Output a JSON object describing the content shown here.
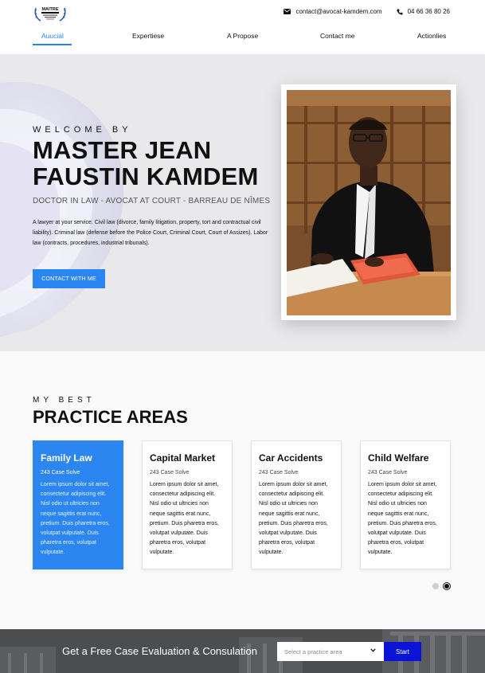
{
  "header": {
    "logo_text": "MAITRE KAMDEM",
    "email": "contact@avocat-kamdem.com",
    "phone": "04 66 36 80 26",
    "nav": [
      {
        "label": "Auucial"
      },
      {
        "label": "Expertiese"
      },
      {
        "label": "A Propose"
      },
      {
        "label": "Contact me"
      },
      {
        "label": "Actionlies"
      }
    ]
  },
  "hero": {
    "welcome": "WELCOME BY",
    "title_line1": "MASTER JEAN",
    "title_line2": "FAUSTIN KAMDEM",
    "subtitle": "DOCTOR IN LAW - AVOCAT AT COURT - BARREAU DE NÎMES",
    "description": "A lawyer at your service. Civil law (divorce, family litigation, property, tort and contractual civil liability). Criminal law (defense before the Police Court, Criminal Court, Court of Assizes). Labor law (contracts, procedures, industrial tribunals).",
    "cta_label": "CONTACT WITH ME"
  },
  "practice": {
    "kicker": "MY BEST",
    "title": "PRACTICE AREAS",
    "cards": [
      {
        "title": "Family Law",
        "count": "243 Case Solve",
        "text": "Lorem ipsum dolor sit amet, consectetur adipiscing elit. Nisl odio ut ultricies non neque sagittis erat nunc, pretium. Duis pharetra eros, volutpat vulputate. Duis pharetra eros, volutpat vulputate."
      },
      {
        "title": "Capital Market",
        "count": "243 Case Solve",
        "text": "Lorem ipsum dolor sit amet, consectetur adipiscing elit. Nisl odio ut ultricies non neque sagittis erat nunc, pretium. Duis pharetra eros, volutpat vulputate. Duis pharetra eros, volutpat vulputate."
      },
      {
        "title": "Car Accidents",
        "count": "243 Case Solve",
        "text": "Lorem ipsum dolor sit amet, consectetur adipiscing elit. Nisl odio ut ultricies non neque sagittis erat nunc, pretium. Duis pharetra eros, volutpat vulputate. Duis pharetra eros, volutpat vulputate."
      },
      {
        "title": "Child Welfare",
        "count": "243 Case Solve",
        "text": "Lorem ipsum dolor sit amet, consectetur adipiscing elit. Nisl odio ut ultricies non neque sagittis erat nunc, pretium. Duis pharetra eros, volutpat vulputate. Duis pharetra eros, volutpat vulputate."
      }
    ]
  },
  "evaluation": {
    "title": "Get a Free Case Evaluation & Consulation",
    "select_placeholder": "Select a practice area",
    "start_label": "Start"
  },
  "colors": {
    "accent": "#2b86f2",
    "start_button": "#0a14d8"
  }
}
